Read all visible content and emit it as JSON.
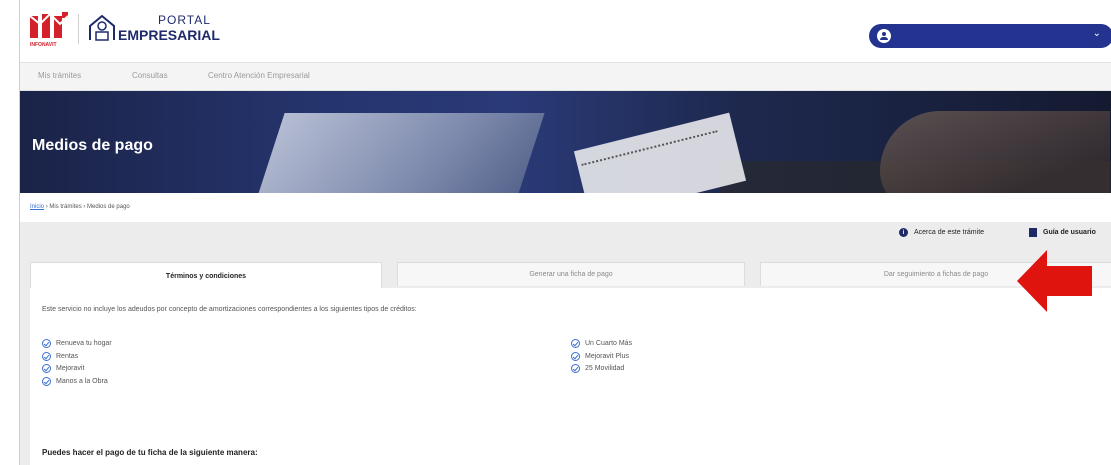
{
  "header": {
    "portal_small": "PORTAL",
    "portal_big": "EMPRESARIAL",
    "infonavit_label": "INFONAVIT",
    "user_name": ""
  },
  "nav": {
    "items": [
      "Mis trámites",
      "Consultas",
      "Centro Atención Empresarial"
    ]
  },
  "hero": {
    "title": "Medios de pago"
  },
  "breadcrumb": {
    "home": "Inicio",
    "sep": "›",
    "level1": "Mis trámites",
    "current": "Medios de pago"
  },
  "actions": {
    "about": "Acerca de este trámite",
    "guide": "Guía de usuario"
  },
  "tabs": [
    {
      "label": "Términos y condiciones",
      "active": true
    },
    {
      "label": "Generar una ficha de pago",
      "active": false
    },
    {
      "label": "Dar seguimiento a fichas de pago",
      "active": false
    }
  ],
  "terms": {
    "intro": "Este servicio no incluye los adeudos por concepto de amortizaciones correspondientes a los siguientes tipos de créditos:",
    "col1": [
      "Renueva tu hogar",
      "Rentas",
      "Mejoravit",
      "Manos a la Obra"
    ],
    "col2": [
      "Un Cuarto Más",
      "Mejoravit Plus",
      "25 Movilidad"
    ],
    "pay_heading": "Puedes hacer el pago de tu ficha de la siguiente manera:"
  },
  "colors": {
    "brand_navy": "#23338f",
    "annotation_red": "#e0140f"
  }
}
